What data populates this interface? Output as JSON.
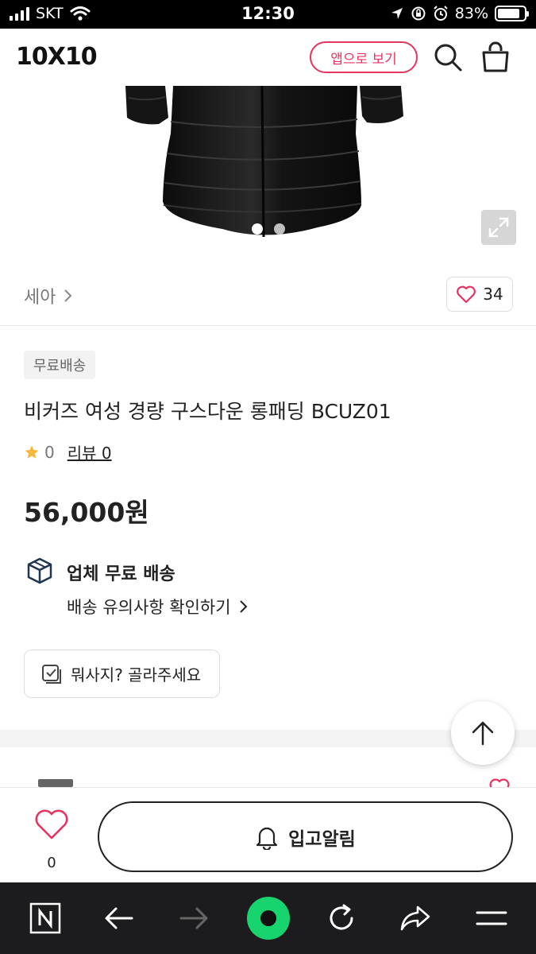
{
  "status_bar": {
    "carrier": "SKT",
    "time": "12:30",
    "battery": "83%",
    "battery_level": 0.83
  },
  "header": {
    "logo": "10X10",
    "app_button": "앱으로 보기",
    "icons": [
      "search-icon",
      "shopping-bag-icon"
    ]
  },
  "gallery": {
    "slide_count": 2,
    "active_slide": 1,
    "zoom_icon": "expand-icon"
  },
  "product": {
    "brand": "세아",
    "like_count": "34",
    "badge": "무료배송",
    "title": "비커즈 여성 경량 구스다운 롱패딩 BCUZ01",
    "rating": "0",
    "review_label": "리뷰 0",
    "price": "56,000원"
  },
  "shipping": {
    "title": "업체 무료 배송",
    "link": "배송 유의사항 확인하기"
  },
  "choose_button": "뭐사지? 골라주세요",
  "buy_bar": {
    "wish_count": "0",
    "notify_label": "입고알림"
  },
  "colors": {
    "accent": "#e6335f",
    "star": "#f5b83d",
    "nav_bg": "#1c1c1e",
    "nav_home": "#18d46e"
  }
}
